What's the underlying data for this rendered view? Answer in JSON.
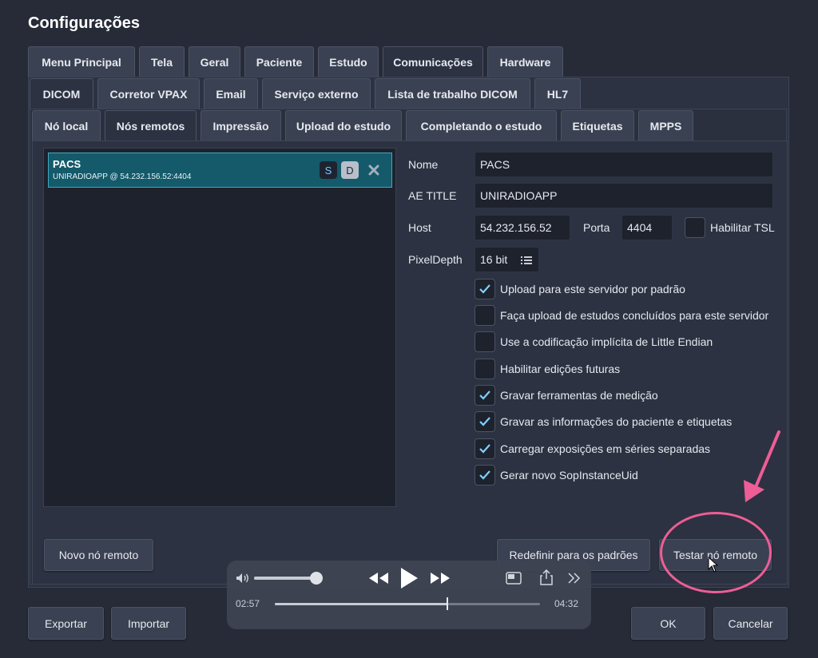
{
  "window": {
    "title": "Configurações"
  },
  "tabs_level1": [
    "Menu Principal",
    "Tela",
    "Geral",
    "Paciente",
    "Estudo",
    "Comunicações",
    "Hardware"
  ],
  "tabs_level2": [
    "DICOM",
    "Corretor VPAX",
    "Email",
    "Serviço externo",
    "Lista de trabalho DICOM",
    "HL7"
  ],
  "tabs_level3": [
    "Nó local",
    "Nós remotos",
    "Impressão",
    "Upload do estudo",
    "Completando o estudo",
    "Etiquetas",
    "MPPS"
  ],
  "active_tabs": {
    "level1": "Comunicações",
    "level2": "DICOM",
    "level3": "Nós remotos"
  },
  "remote_nodes": [
    {
      "name": "PACS",
      "address": "UNIRADIOAPP @ 54.232.156.52:4404",
      "badge_s": "S",
      "badge_d": "D",
      "delete_icon": "close-icon"
    }
  ],
  "form": {
    "nome_label": "Nome",
    "nome_value": "PACS",
    "ae_title_label": "AE TITLE",
    "ae_title_value": "UNIRADIOAPP",
    "host_label": "Host",
    "host_value": "54.232.156.52",
    "porta_label": "Porta",
    "porta_value": "4404",
    "tls_label": "Habilitar TSL",
    "tls_checked": false,
    "pixel_depth_label": "PixelDepth",
    "pixel_depth_value": "16 bit"
  },
  "options": [
    {
      "label": "Upload para este servidor por padrão",
      "checked": true
    },
    {
      "label": "Faça upload de estudos concluídos para este servidor",
      "checked": false
    },
    {
      "label": "Use a codificação implícita de Little Endian",
      "checked": false
    },
    {
      "label": "Habilitar edições futuras",
      "checked": false
    },
    {
      "label": "Gravar ferramentas de medição",
      "checked": true
    },
    {
      "label": "Gravar as informações do paciente e etiquetas",
      "checked": true
    },
    {
      "label": "Carregar exposições em séries separadas",
      "checked": true
    },
    {
      "label": "Gerar novo SopInstanceUid",
      "checked": true
    }
  ],
  "buttons": {
    "novo_no": "Novo nó remoto",
    "redefinir": "Redefinir para os padrões",
    "testar": "Testar nó remoto",
    "exportar": "Exportar",
    "importar": "Importar",
    "ok": "OK",
    "cancelar": "Cancelar"
  },
  "player": {
    "current_time": "02:57",
    "total_time": "04:32",
    "progress": 0.65,
    "volume": 1.0
  },
  "colors": {
    "background": "#262b37",
    "selected_item": "#145a6b",
    "annotation": "#ef5d96",
    "check_accent": "#7fd0ff"
  }
}
